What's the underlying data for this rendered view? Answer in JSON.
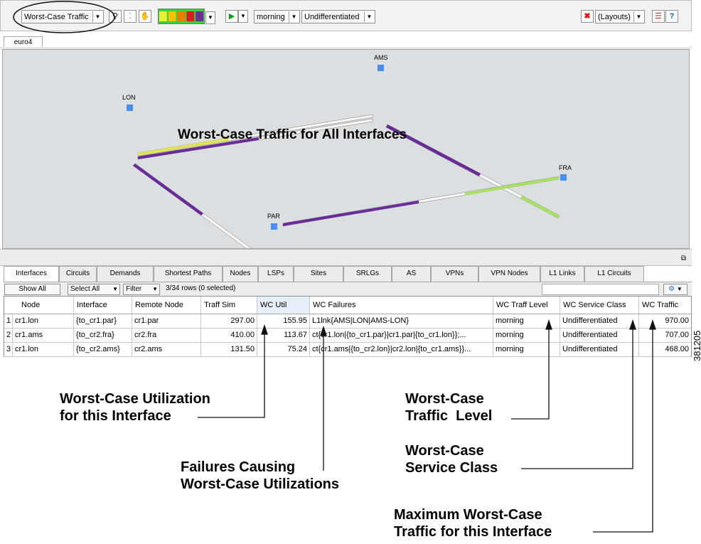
{
  "toolbar": {
    "plot_selector": "Worst-Case Traffic",
    "traffic_level": "morning",
    "service_class": "Undifferentiated",
    "layouts": "(Layouts)",
    "palette": [
      "#e9ef34",
      "#f5c300",
      "#ee7a00",
      "#d81e1e",
      "#6c2e98"
    ],
    "palette_bg": "#3ad03a",
    "icons": [
      "zoom-icon",
      "select-nodes-icon",
      "pan-hand-icon",
      "play-simulation-icon",
      "delete-icon",
      "checklist-icon",
      "help-icon"
    ]
  },
  "document_tab": "euro4",
  "map": {
    "title": "Worst-Case Traffic for All Interfaces",
    "nodes": [
      "AMS",
      "LON",
      "FRA",
      "PAR"
    ],
    "node_color": "#4a8ff0",
    "link_colors": {
      "purple": "#6a2c96",
      "yellow": "#e3e64e",
      "light_green": "#a8e060",
      "white": "#f7f7f7"
    }
  },
  "bottom_tabs": [
    "Interfaces",
    "Circuits",
    "Demands",
    "Shortest Paths",
    "Nodes",
    "LSPs",
    "Sites",
    "SRLGs",
    "AS",
    "VPNs",
    "VPN Nodes",
    "L1 Links",
    "L1 Circuits"
  ],
  "filter_bar": {
    "show_all": "Show All",
    "select_all": "Select All",
    "filter": "Filter",
    "row_count": "3/34 rows (0 selected)"
  },
  "table": {
    "columns": [
      "Node",
      "Interface",
      "Remote Node",
      "Traff Sim",
      "WC Util",
      "WC Failures",
      "WC Traff Level",
      "WC Service Class",
      "WC Traffic"
    ],
    "rows": [
      {
        "index": "1",
        "node": "cr1.lon",
        "interface": "{to_cr1.par}",
        "remote_node": "cr1.par",
        "traff_sim": "297.00",
        "wc_util": "155.95",
        "wc_failures": "L1lnk{AMS|LON|AMS-LON}",
        "wc_traff_level": "morning",
        "wc_service_class": "Undifferentiated",
        "wc_traffic": "970.00"
      },
      {
        "index": "2",
        "node": "cr1.ams",
        "interface": "{to_cr2.fra}",
        "remote_node": "cr2.fra",
        "traff_sim": "410.00",
        "wc_util": "113.67",
        "wc_failures": "ct{cr1.lon|{to_cr1.par}|cr1.par|{to_cr1.lon}};...",
        "wc_traff_level": "morning",
        "wc_service_class": "Undifferentiated",
        "wc_traffic": "707.00"
      },
      {
        "index": "3",
        "node": "cr1.lon",
        "interface": "{to_cr2.ams}",
        "remote_node": "cr2.ams",
        "traff_sim": "131.50",
        "wc_util": "75.24",
        "wc_failures": "ct{cr1.ams|{to_cr2.lon}|cr2.lon|{to_cr1.ams}}...",
        "wc_traff_level": "morning",
        "wc_service_class": "Undifferentiated",
        "wc_traffic": "468.00"
      }
    ]
  },
  "figure_id": "381205",
  "callouts": {
    "wc_util": [
      "Worst-Case Utilization",
      "for this Interface"
    ],
    "wc_failures": [
      "Failures Causing",
      "Worst-Case Utilizations"
    ],
    "wc_traff_level": [
      "Worst-Case",
      "Traffic  Level"
    ],
    "wc_service_class": [
      "Worst-Case",
      "Service Class"
    ],
    "wc_traffic": [
      "Maximum Worst-Case",
      "Traffic for this Interface"
    ]
  }
}
